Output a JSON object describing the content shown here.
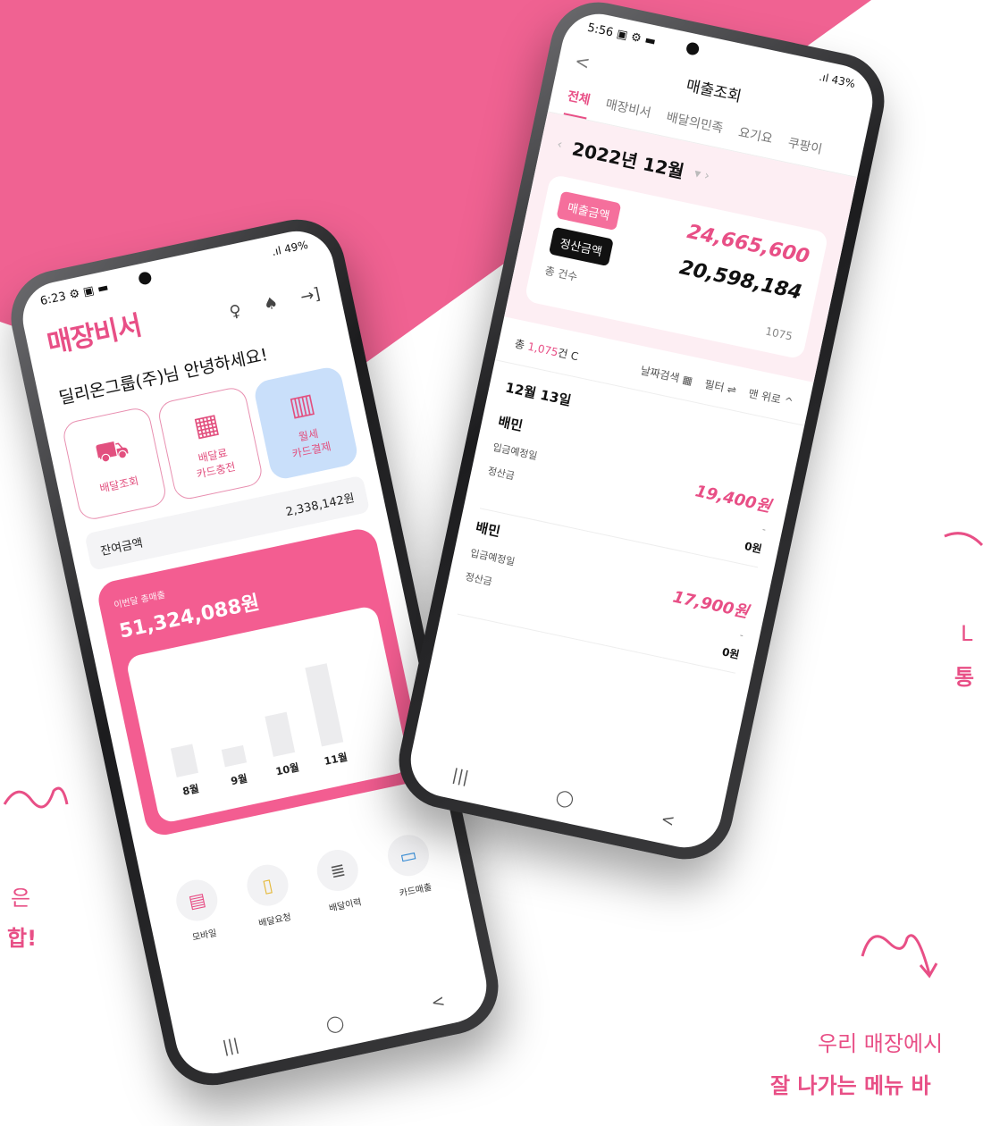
{
  "left_phone": {
    "status_time": "6:23",
    "status_icons": "⚙ ▣ ▬",
    "battery": ".ıl 49%",
    "brand": "매장비서",
    "greeting": "딜리온그룹(주)님 안녕하세요!",
    "tiles": [
      {
        "label": "배달조회",
        "icon": "scooter-icon"
      },
      {
        "label": "배달료\n카드충전",
        "icon": "box-icon"
      },
      {
        "label": "월세\n카드결제",
        "icon": "building-icon"
      }
    ],
    "balance_label": "잔여금액",
    "balance_value": "2,338,142원",
    "sales_label": "이번달 총매출",
    "sales_value": "51,324,088원",
    "chart_data": {
      "type": "bar",
      "categories": [
        "8월",
        "9월",
        "10월",
        "11월"
      ],
      "values": [
        30,
        18,
        42,
        82
      ],
      "title": "",
      "xlabel": "",
      "ylabel": ""
    },
    "quick_menu": [
      "모바일",
      "배달요청",
      "배달이력",
      "카드매출"
    ],
    "nav": [
      "|||",
      "◯",
      "<"
    ]
  },
  "right_phone": {
    "status_time": "5:56",
    "status_icons": "▣ ⚙ ▬",
    "battery": ".ıl 43%",
    "back": "<",
    "title": "매출조회",
    "tabs": [
      "전체",
      "매장비서",
      "배달의민족",
      "요기요",
      "쿠팡이"
    ],
    "month": "2022년 12월",
    "sales_pill": "매출금액",
    "sales_amount": "24,665,600",
    "settle_pill": "정산금액",
    "settle_amount": "20,598,184",
    "count_label": "총 건수",
    "count_value": "1075",
    "total_prefix": "총",
    "total_count": "1,075",
    "total_suffix": "건 C",
    "date_search": "날짜검색",
    "filter": "필터",
    "to_top": "맨 위로",
    "date_header": "12월 13일",
    "entries": [
      {
        "name": "배민",
        "line1": "입금예정일",
        "amount": "19,400원",
        "line2": "정산금",
        "dash": "-",
        "zero": "0원"
      },
      {
        "name": "배민",
        "line1": "입금예정일",
        "amount": "17,900원",
        "line2": "정산금",
        "dash": "-",
        "zero": "0원"
      }
    ],
    "nav": [
      "|||",
      "◯",
      "<"
    ]
  },
  "captions": {
    "left_1": "은",
    "left_2": "합!",
    "right_1": "L",
    "right_2": "통",
    "bottom_1": "우리 매장에시",
    "bottom_2": "잘 나가는 메뉴 바"
  },
  "colors": {
    "brand": "#e84f86",
    "pink_bg": "#f06292",
    "tile_active": "#c9dffa"
  }
}
